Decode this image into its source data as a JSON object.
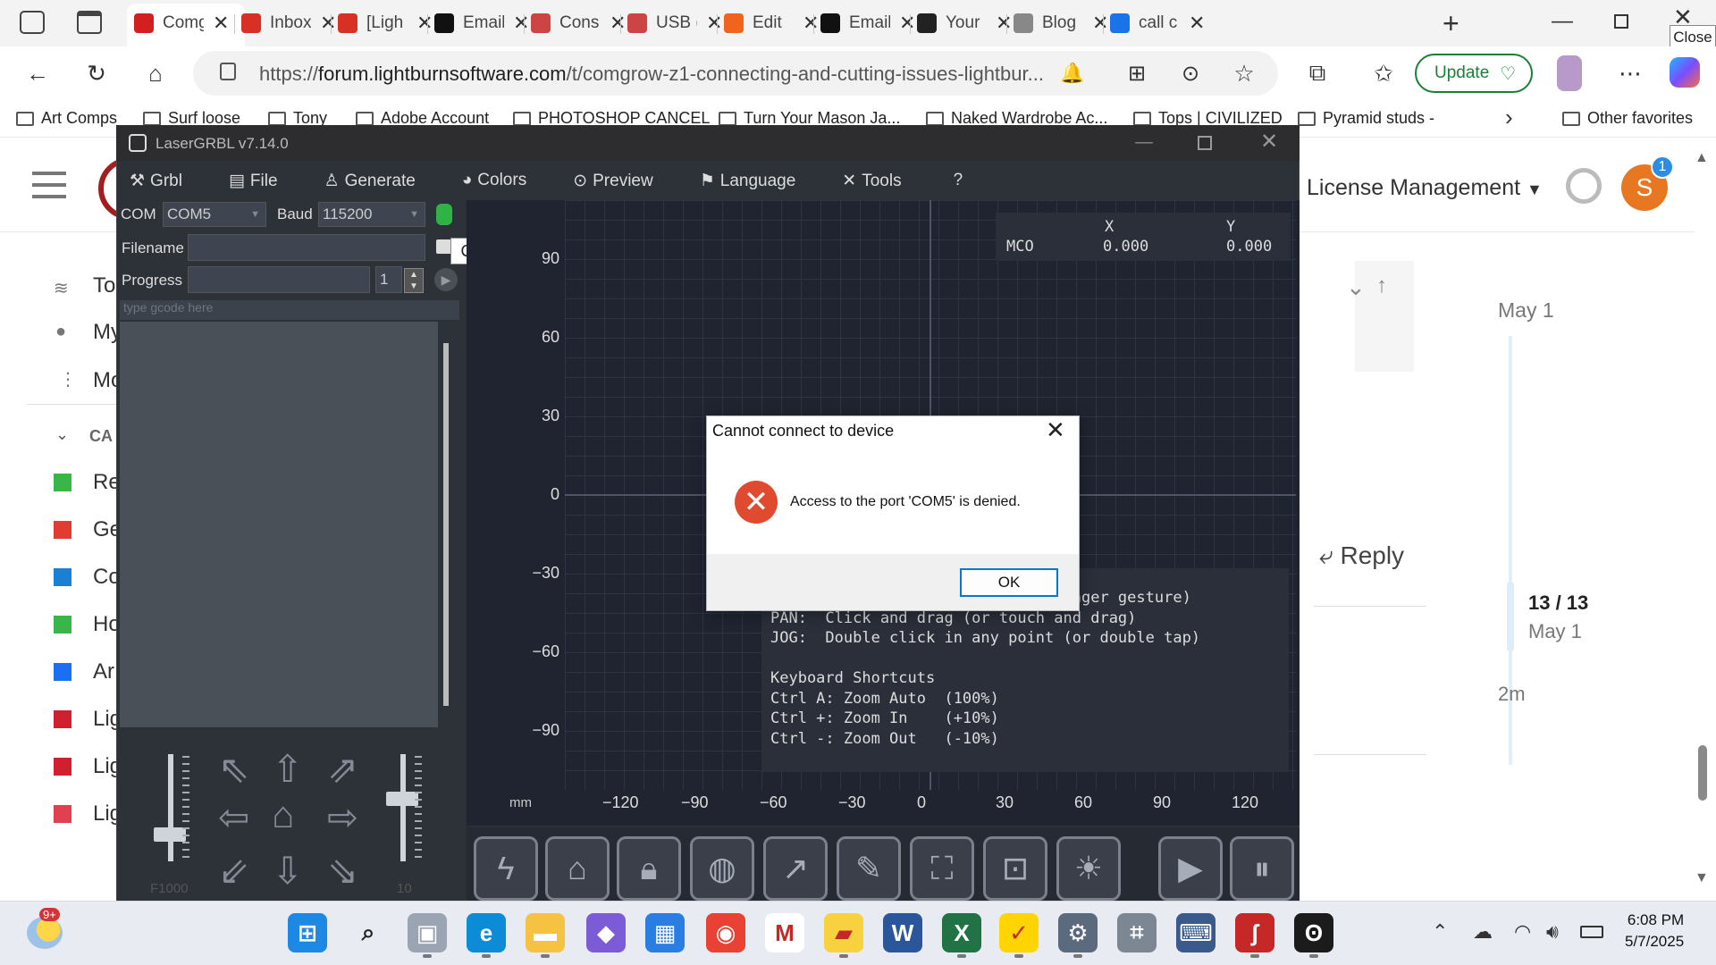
{
  "browser": {
    "tabs": [
      {
        "title": "Comg",
        "favicon": "lightburn-icon",
        "color": "#d21f1f",
        "active": true
      },
      {
        "title": "Inbox",
        "favicon": "gmail-icon",
        "color": "#d93025"
      },
      {
        "title": "[Ligh",
        "favicon": "gmail-icon",
        "color": "#d93025"
      },
      {
        "title": "Email",
        "favicon": "wix-icon",
        "color": "#111111"
      },
      {
        "title": "Cons",
        "favicon": "lightburn-icon",
        "color": "#c44"
      },
      {
        "title": "USB (",
        "favicon": "lightburn-icon",
        "color": "#c44"
      },
      {
        "title": "Edit",
        "favicon": "etsy-icon",
        "color": "#f1641e"
      },
      {
        "title": "Email",
        "favicon": "wix-icon",
        "color": "#111111"
      },
      {
        "title": "Your",
        "favicon": "amazon-icon",
        "color": "#222222"
      },
      {
        "title": "Blog",
        "favicon": "wix-icon",
        "color": "#888888"
      },
      {
        "title": "call c",
        "favicon": "search-icon",
        "color": "#1a73e8"
      }
    ],
    "url_prefix": "https://",
    "url_domain": "forum.lightburnsoftware.com",
    "url_path": "/t/comgrow-z1-connecting-and-cutting-issues-lightbur...",
    "update_label": "Update",
    "close_tooltip": "Close",
    "bookmarks": [
      "Art Comps",
      "Surf loose",
      "Tony",
      "Adobe Account",
      "PHOTOSHOP CANCEL",
      "Turn Your Mason Ja...",
      "Naked Wardrobe Ac...",
      "Tops | CIVILIZED",
      "Pyramid studs -"
    ],
    "other_favorites": "Other favorites"
  },
  "forum": {
    "license_management": "License Management",
    "avatar_letter": "S",
    "notification_count": "1",
    "sidebar_items": [
      "To",
      "My",
      "Mo"
    ],
    "categories_label": "CA",
    "category_items": [
      {
        "label": "Re",
        "color": "#3ab54a"
      },
      {
        "label": "Ge",
        "color": "#e03c31"
      },
      {
        "label": "Co",
        "color": "#1b7fd3"
      },
      {
        "label": "Ho",
        "color": "#3ab54a"
      },
      {
        "label": "Ar",
        "color": "#1b6ff3"
      },
      {
        "label": "Lig",
        "color": "#d0202f"
      },
      {
        "label": "Lig",
        "color": "#d0202f"
      },
      {
        "label": "Lig",
        "color": "#e04050"
      }
    ],
    "timeline_top_date": "May 1",
    "reply_label": "Reply",
    "progress": "13 / 13",
    "progress_date": "May 1",
    "last_activity": "2m"
  },
  "lasergrbl": {
    "title": "LaserGRBL v7.14.0",
    "menu": [
      "Grbl",
      "File",
      "Generate",
      "Colors",
      "Preview",
      "Language",
      "Tools",
      "?"
    ],
    "com_label": "COM",
    "com_value": "COM5",
    "baud_label": "Baud",
    "baud_value": "115200",
    "filename_label": "Filename",
    "progress_label": "Progress",
    "progress_count": "1",
    "gcode_placeholder": "type gcode here",
    "connect_tooltip": "Connect",
    "speed_label": "F1000",
    "step_label": "10",
    "mco_label": "MCO",
    "x_label": "X",
    "y_label": "Y",
    "x_value": "0.000",
    "y_value": "0.000",
    "y_ticks": [
      "90",
      "60",
      "30",
      "0",
      "−30",
      "−60",
      "−90"
    ],
    "x_ticks": [
      "−120",
      "−90",
      "−60",
      "−30",
      "0",
      "30",
      "60",
      "90",
      "120"
    ],
    "unit_label": "mm",
    "help_text": "                             o-finger gesture)\nPAN:  Click and drag (or touch and drag)\nJOG:  Double click in any point (or double tap)\n\nKeyboard Shortcuts\nCtrl A: Zoom Auto  (100%)\nCtrl +: Zoom In    (+10%)\nCtrl -: Zoom Out   (-10%)"
  },
  "dialog": {
    "title": "Cannot connect to device",
    "message": "Access to the port 'COM5' is denied.",
    "ok_label": "OK"
  },
  "taskbar": {
    "weather_badge": "9+",
    "time": "6:08 PM",
    "date": "5/7/2025"
  }
}
